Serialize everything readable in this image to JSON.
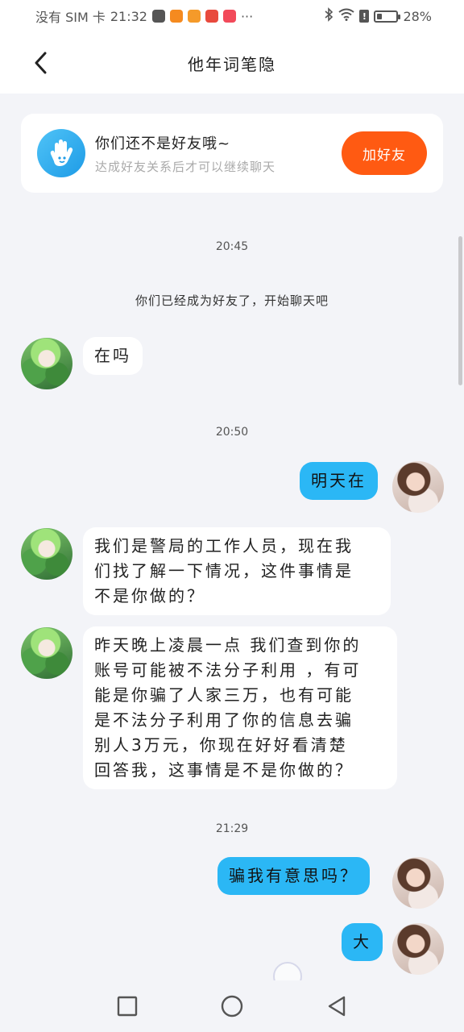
{
  "status_bar": {
    "carrier": "没有 SIM 卡",
    "time": "21:32",
    "more": "···",
    "battery_text": "28%",
    "battery_level": 0.28,
    "warn": "!"
  },
  "header": {
    "title": "他年词笔隐"
  },
  "friend_banner": {
    "title": "你们还不是好友哦~",
    "subtitle": "达成好友关系后才可以继续聊天",
    "button_label": "加好友"
  },
  "messages": {
    "time_1": "20:45",
    "system_1": "你们已经成为好友了，开始聊天吧",
    "in_1": "在吗",
    "time_2": "20:50",
    "out_1": "明天在",
    "in_2_line1": "我们是警局的工作人员，现在我",
    "in_2_line2": "们找了解一下情况，这件事情是",
    "in_2_line3": "不是你做的？",
    "in_3_line1": "昨天晚上凌晨一点 我们查到你的",
    "in_3_line2": "账号可能被不法分子利用 ，有可",
    "in_3_line3": "能是你骗了人家三万，也有可能",
    "in_3_line4": "是不法分子利用了你的信息去骗",
    "in_3_line5": "别人3万元，你现在好好看清楚",
    "in_3_line6": "回答我，这事情是不是你做的？",
    "time_3": "21:29",
    "out_2": "骗我有意思吗？",
    "out_3": "大"
  },
  "colors": {
    "accent_orange": "#ff5a12",
    "outgoing_bubble": "#2bb7f5",
    "background": "#f3f4f8"
  },
  "icons": {
    "back": "back-arrow-icon",
    "hand": "hand-wave-icon",
    "nav_recent": "square-icon",
    "nav_home": "circle-icon",
    "nav_back": "triangle-back-icon"
  }
}
